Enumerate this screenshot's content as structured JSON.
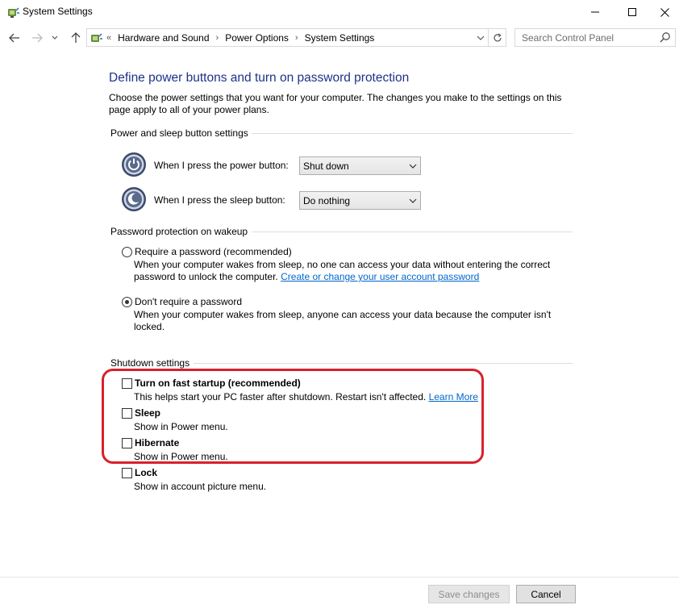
{
  "window": {
    "title": "System Settings",
    "icons": {
      "app": "power-options-icon",
      "minimize": "minimize-icon",
      "maximize": "maximize-icon",
      "close": "close-icon"
    }
  },
  "navigation": {
    "back": "back-arrow-icon",
    "forward": "forward-arrow-icon",
    "recent": "chevron-down-icon",
    "up": "up-arrow-icon",
    "overflow": "«",
    "breadcrumbs": [
      "Hardware and Sound",
      "Power Options",
      "System Settings"
    ],
    "refresh": "refresh-icon",
    "search_placeholder": "Search Control Panel"
  },
  "main": {
    "title": "Define power buttons and turn on password protection",
    "intro": "Choose the power settings that you want for your computer. The changes you make to the settings on this page apply to all of your power plans.",
    "power_section": {
      "heading": "Power and sleep button settings",
      "power_button": {
        "label": "When I press the power button:",
        "value": "Shut down"
      },
      "sleep_button": {
        "label": "When I press the sleep button:",
        "value": "Do nothing"
      }
    },
    "password_section": {
      "heading": "Password protection on wakeup",
      "require": {
        "label": "Require a password (recommended)",
        "checked": false,
        "desc1": "When your computer wakes from sleep, no one can access your data without entering the correct",
        "desc2": "password to unlock the computer.",
        "link": "Create or change your user account password"
      },
      "no_require": {
        "label": "Don't require a password",
        "checked": true,
        "desc": "When your computer wakes from sleep, anyone can access your data because the computer isn't locked."
      }
    },
    "shutdown_section": {
      "heading": "Shutdown settings",
      "fast_startup": {
        "label": "Turn on fast startup (recommended)",
        "desc": "This helps start your PC faster after shutdown. Restart isn't affected.",
        "link": "Learn More",
        "checked": false
      },
      "sleep": {
        "label": "Sleep",
        "desc": "Show in Power menu.",
        "checked": false
      },
      "hibernate": {
        "label": "Hibernate",
        "desc": "Show in Power menu.",
        "checked": false
      },
      "lock": {
        "label": "Lock",
        "desc": "Show in account picture menu.",
        "checked": false
      }
    },
    "highlight_color": "#d9202c"
  },
  "footer": {
    "save": "Save changes",
    "cancel": "Cancel"
  }
}
